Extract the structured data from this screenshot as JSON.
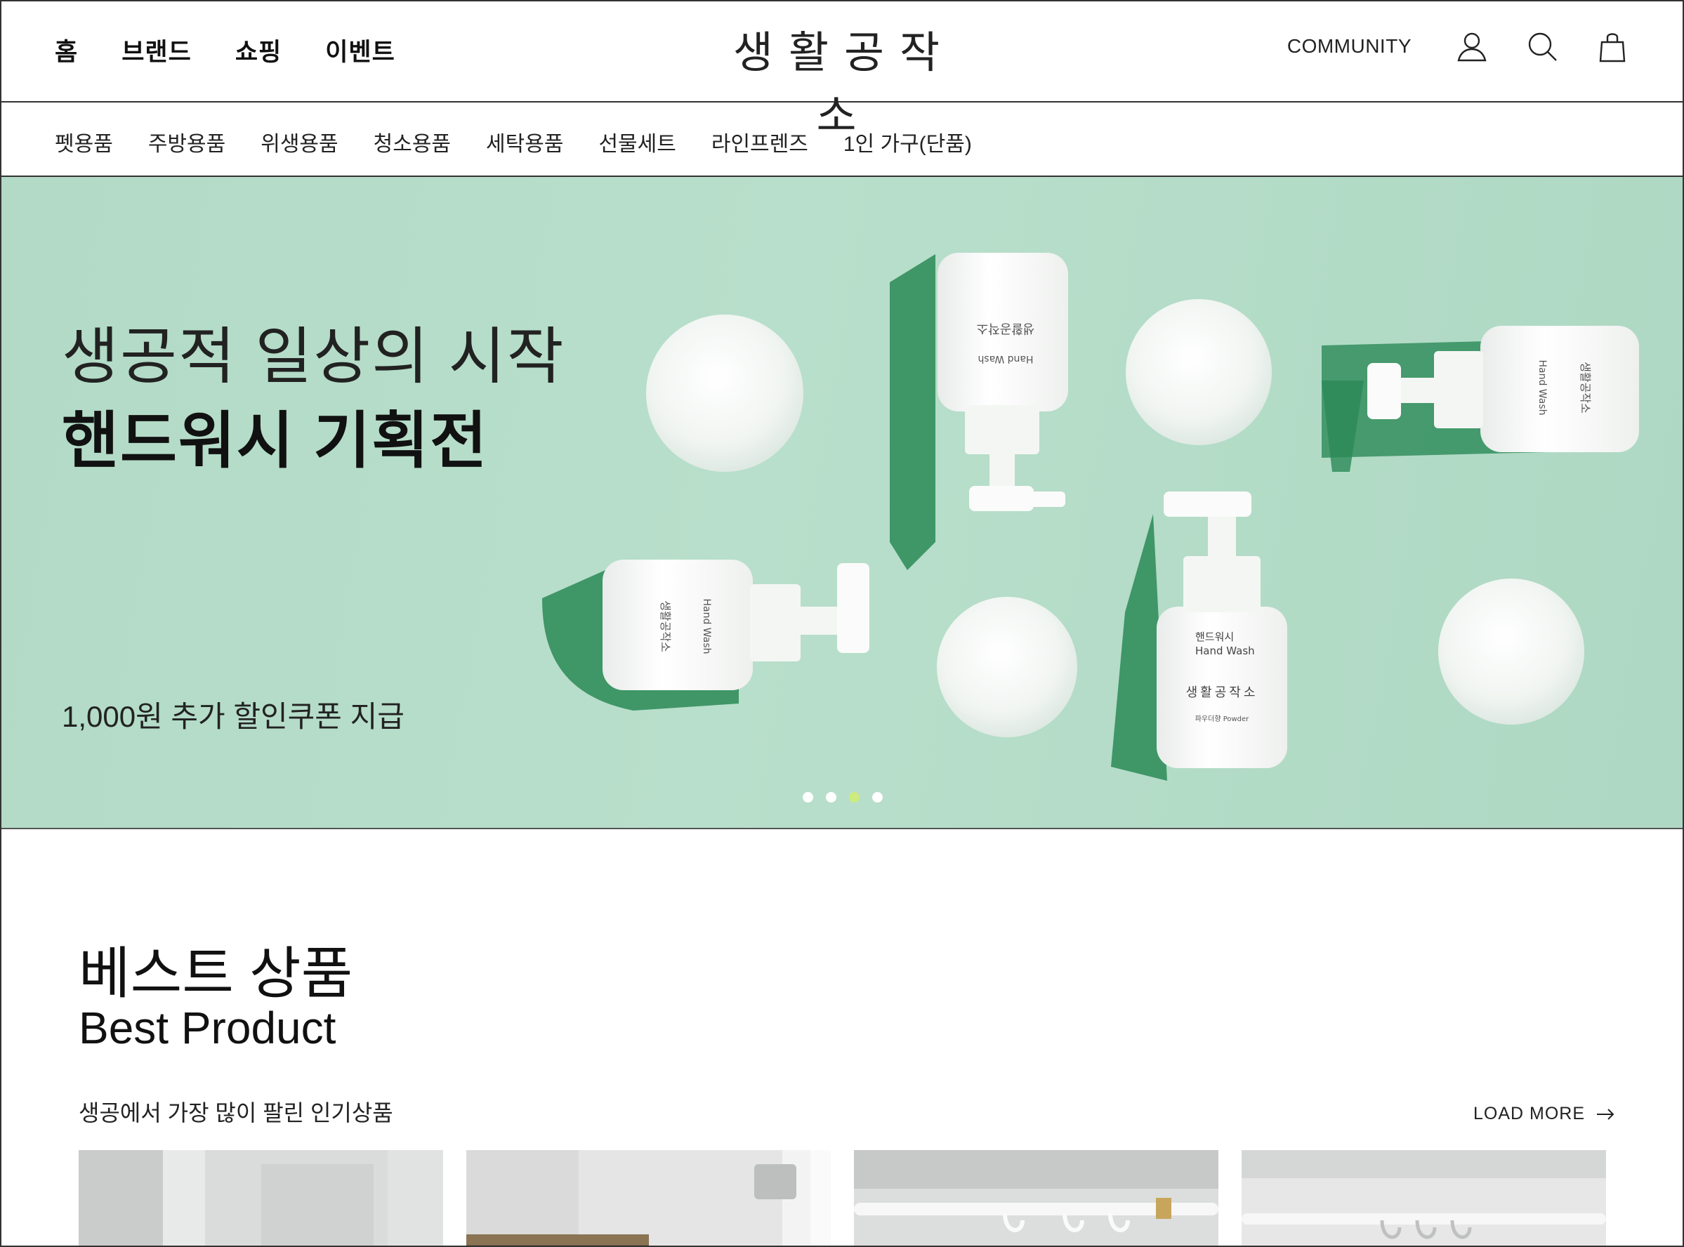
{
  "header": {
    "nav": [
      "홈",
      "브랜드",
      "쇼핑",
      "이벤트"
    ],
    "logo": "생활공작소",
    "community": "COMMUNITY",
    "icons": [
      "user-icon",
      "search-icon",
      "shopping-bag-icon"
    ]
  },
  "sub_nav": [
    "펫용품",
    "주방용품",
    "위생용품",
    "청소용품",
    "세탁용품",
    "선물세트",
    "라인프렌즈",
    "1인 가구(단품)"
  ],
  "hero": {
    "subtitle": "생공적 일상의 시작",
    "title": "핸드워시 기획전",
    "coupon": "1,000원 추가 할인쿠폰 지급",
    "bottle_label_ko": "핸드워시",
    "bottle_label_en": "Hand Wash",
    "bottle_brand": "생활공작소",
    "bottle_variant": "파우더향 Powder",
    "slide_count": 4,
    "active_slide": 3,
    "background_color": "#b2dac6",
    "active_dot_color": "#cdeb7e"
  },
  "best": {
    "title_ko": "베스트 상품",
    "title_en": "Best Product",
    "description": "생공에서 가장 많이 팔린 인기상품",
    "load_more": "LOAD MORE"
  }
}
